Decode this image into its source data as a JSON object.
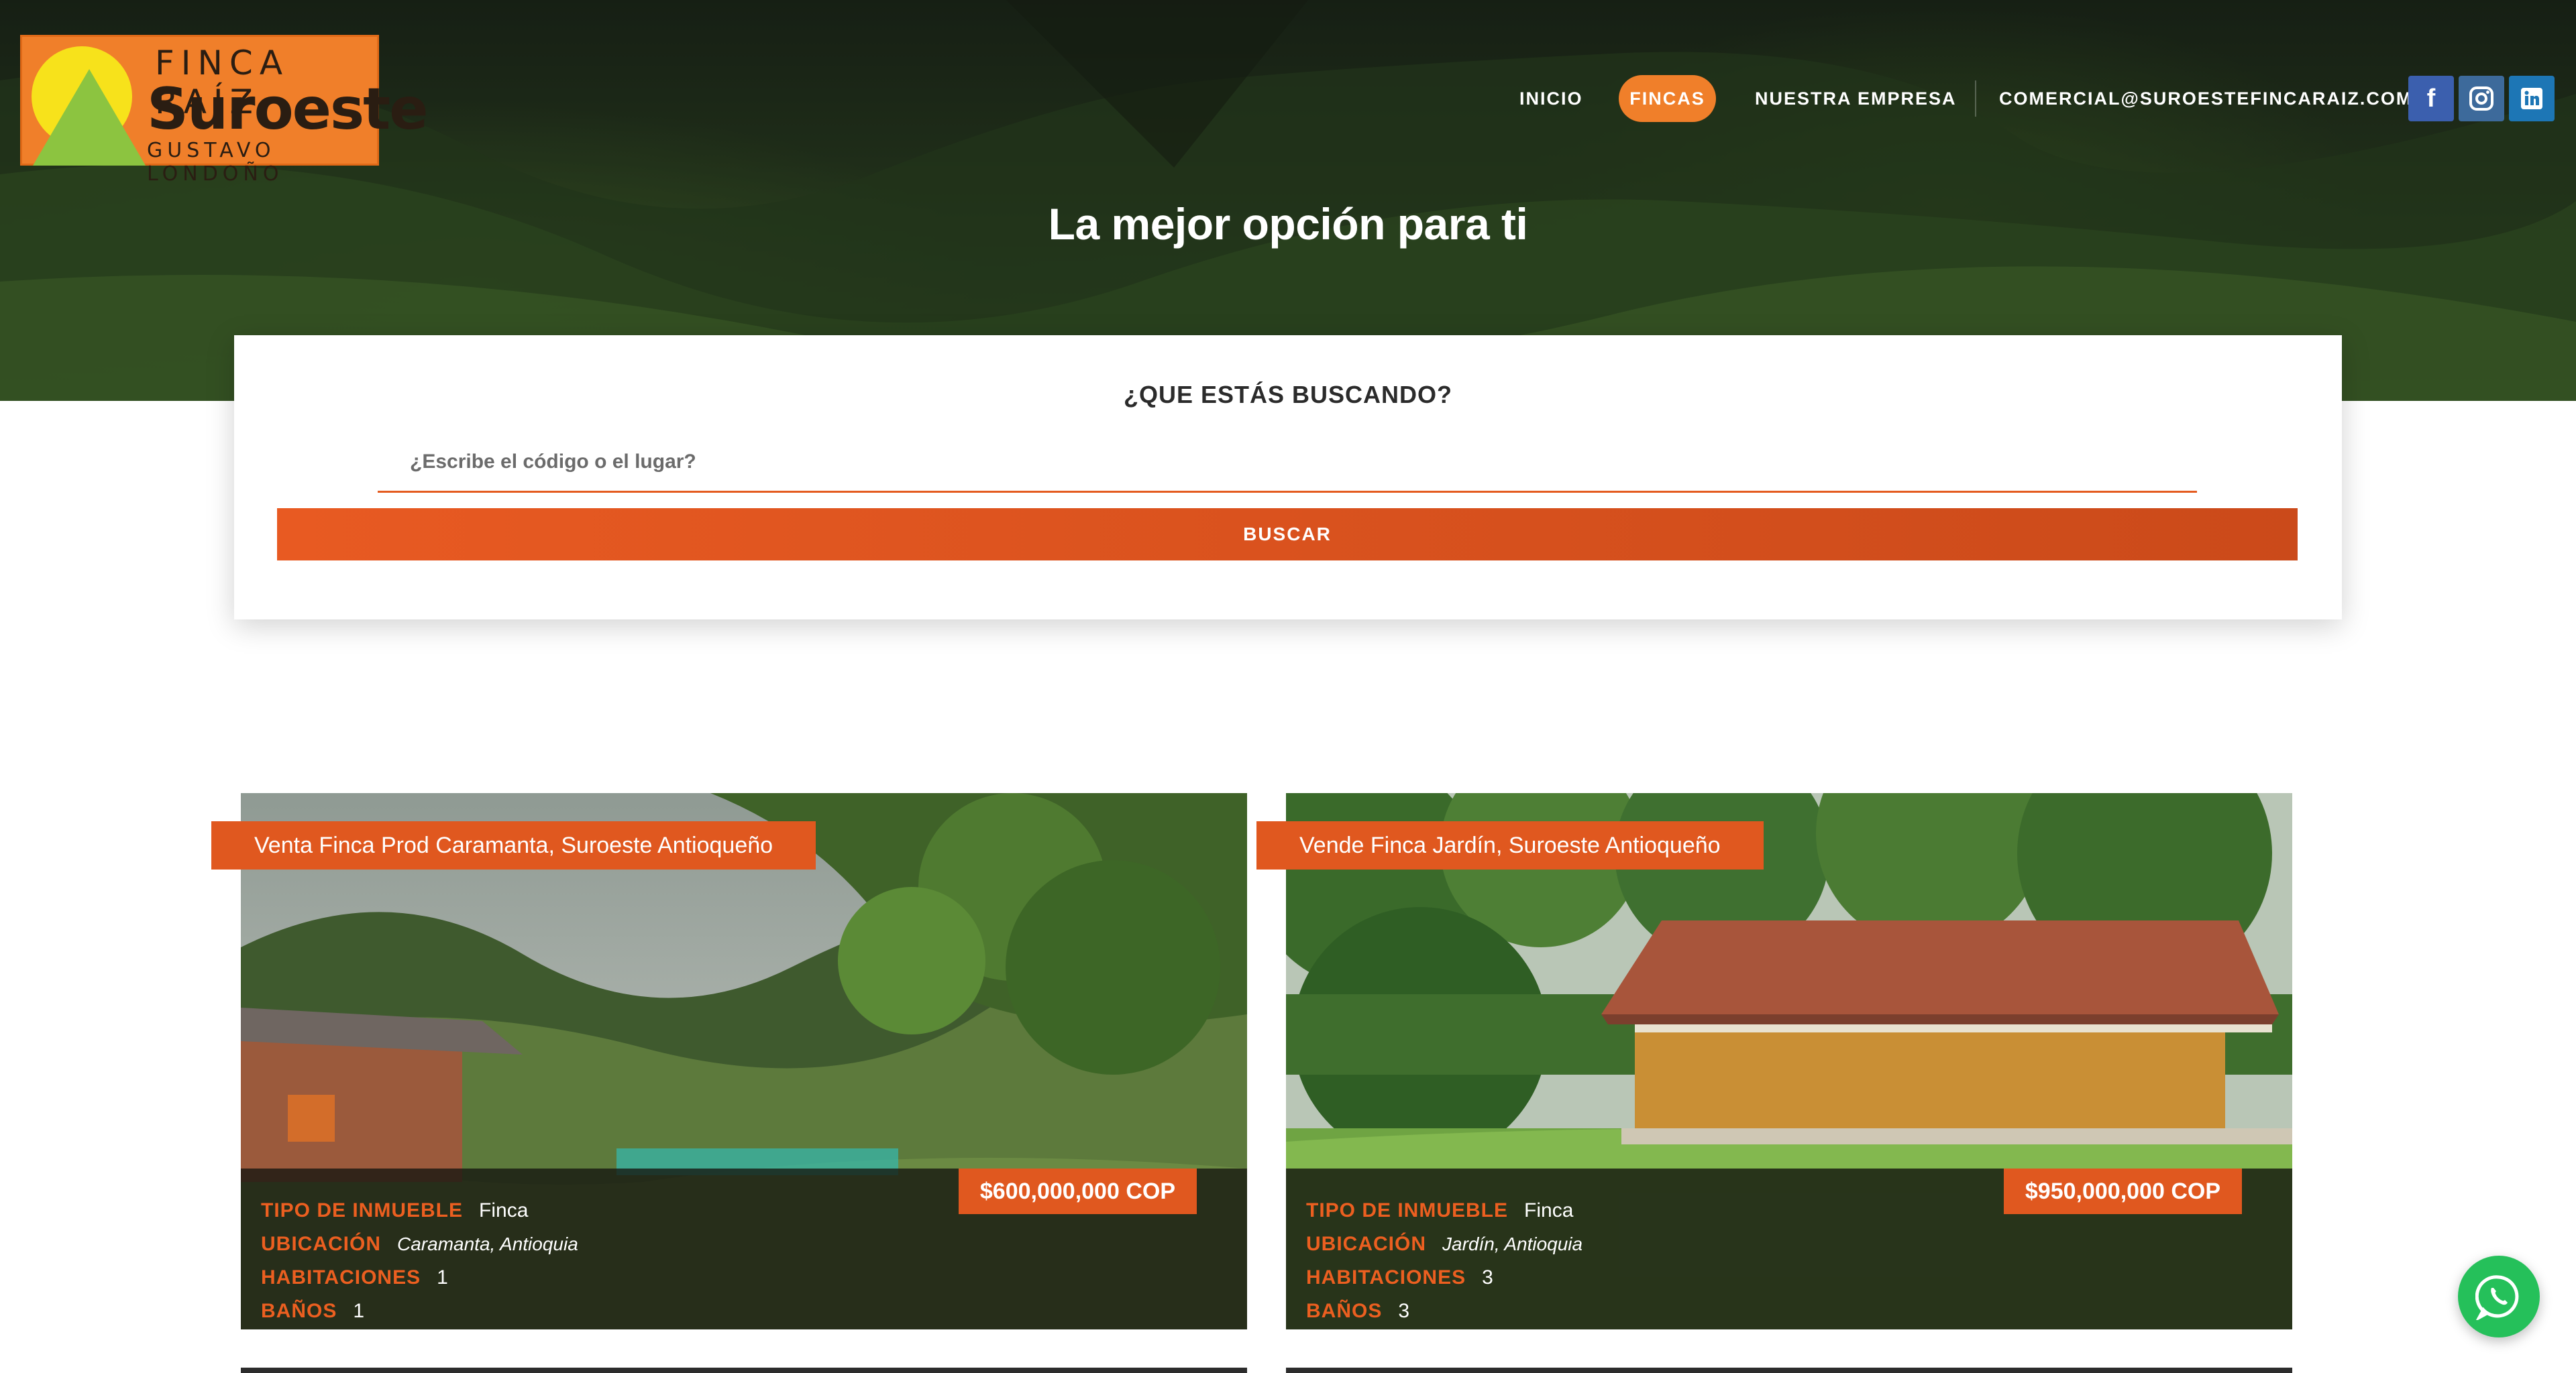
{
  "logo": {
    "line1": "FINCA RAÍZ",
    "line2": "Suroeste",
    "line3": "GUSTAVO LONDOÑO"
  },
  "nav": {
    "items": [
      "INICIO",
      "FINCAS",
      "NUESTRA EMPRESA",
      "COMERCIAL@SUROESTEFINCARAIZ.COM"
    ],
    "active": "FINCAS"
  },
  "social": {
    "facebook_icon": "facebook-icon",
    "instagram_icon": "instagram-icon",
    "linkedin_icon": "linkedin-icon"
  },
  "hero": {
    "title": "La mejor opción para ti"
  },
  "search": {
    "heading": "¿QUE ESTÁS BUSCANDO?",
    "placeholder": "¿Escribe el código o el lugar?",
    "button": "BUSCAR"
  },
  "listings": [
    {
      "title": "Venta Finca Prod Caramanta, Suroeste Antioqueño",
      "price": "$600,000,000 COP",
      "fields": [
        {
          "label": "TIPO DE INMUEBLE",
          "value": "Finca"
        },
        {
          "label": "UBICACIÓN",
          "value": "Caramanta, Antioquia"
        },
        {
          "label": "HABITACIONES",
          "value": "1"
        },
        {
          "label": "BAÑOS",
          "value": "1"
        }
      ]
    },
    {
      "title": "Vende Finca Jardín, Suroeste Antioqueño",
      "price": "$950,000,000 COP",
      "fields": [
        {
          "label": "TIPO DE INMUEBLE",
          "value": "Finca"
        },
        {
          "label": "UBICACIÓN",
          "value": "Jardín, Antioquia"
        },
        {
          "label": "HABITACIONES",
          "value": "3"
        },
        {
          "label": "BAÑOS",
          "value": "3"
        }
      ]
    }
  ],
  "colors": {
    "accent": "#e0581f",
    "nav_active": "#f07f2a",
    "whatsapp": "#25c05a"
  },
  "whatsapp_icon": "whatsapp-icon"
}
